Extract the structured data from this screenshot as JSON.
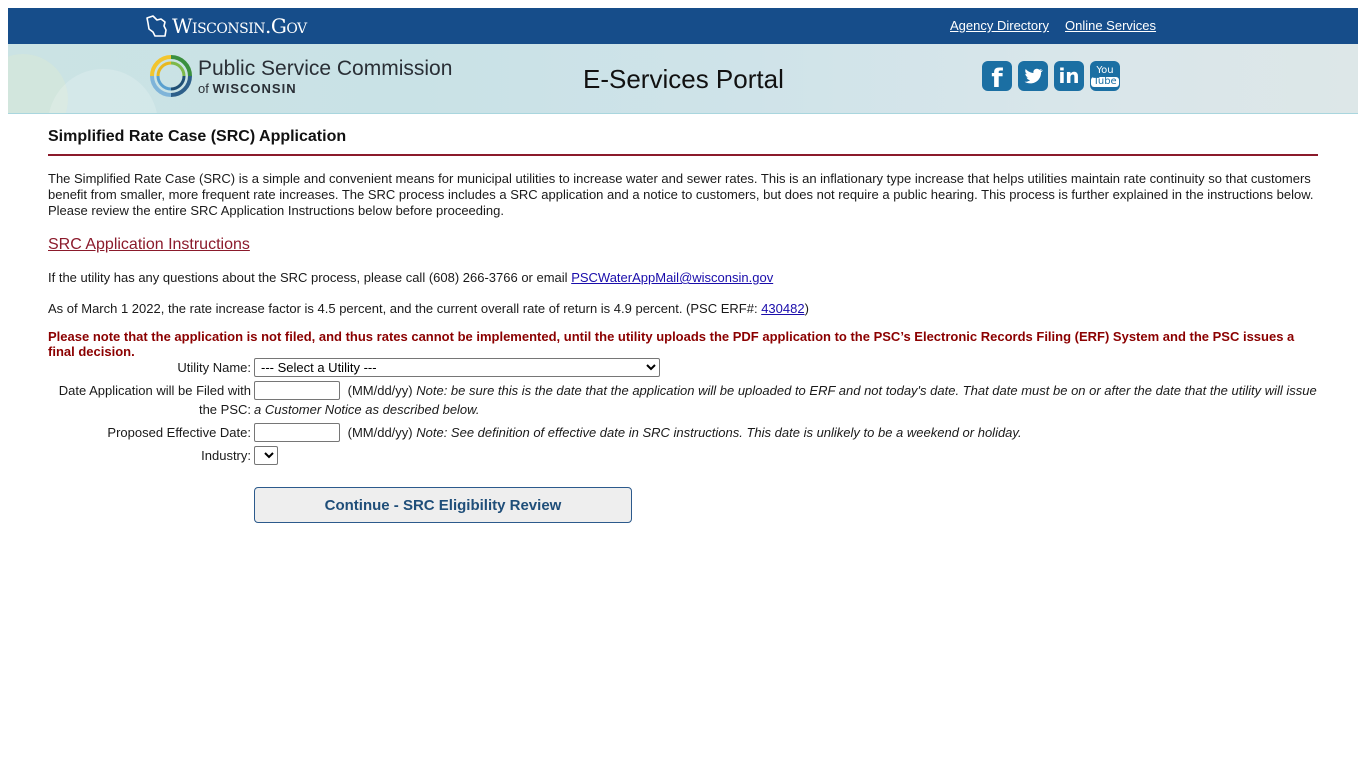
{
  "govbar": {
    "wordmark": "Wisconsin.Gov",
    "links": [
      {
        "label": "Agency Directory"
      },
      {
        "label": "Online Services"
      }
    ]
  },
  "banner": {
    "org_line1": "Public Service Commission",
    "org_line2_prefix": "of",
    "org_line2_bold": "WISCONSIN",
    "portal_title": "E-Services Portal",
    "social": [
      {
        "name": "facebook-icon",
        "glyph": "f"
      },
      {
        "name": "twitter-icon",
        "glyph": ""
      },
      {
        "name": "linkedin-icon",
        "glyph": "in"
      },
      {
        "name": "youtube-icon",
        "glyph_top": "You",
        "glyph_bottom": "Tube"
      }
    ],
    "colors": {
      "govbar": "#164d8a",
      "social": "#1b6fa3"
    }
  },
  "page": {
    "title": "Simplified Rate Case (SRC) Application",
    "intro": "The Simplified Rate Case (SRC) is a simple and convenient means for municipal utilities to increase water and sewer rates. This is an inflationary type increase that helps utilities maintain rate continuity so that customers benefit from smaller, more frequent rate increases. The SRC process includes a SRC application and a notice to customers, but does not require a public hearing. This process is further explained in the instructions below. Please review the entire SRC Application Instructions below before proceeding.",
    "instructions_link": "SRC Application Instructions",
    "contact_prefix": "If the utility has any questions about the SRC process, please call (608) 266-3766 or email ",
    "contact_email": "PSCWaterAppMail@wisconsin.gov",
    "rate_prefix": "As of March 1 2022, the rate increase factor is 4.5 percent, and the current overall rate of return is 4.9 percent. (PSC ERF#: ",
    "rate_erf_link": "430482",
    "rate_suffix": ")",
    "warning": "Please note that the application is not filed, and thus rates cannot be implemented, until the utility uploads the PDF application to the PSC’s Electronic Records Filing (ERF) System and the PSC issues a final decision.",
    "accent_color": "#8b1a2b"
  },
  "form": {
    "utility_label": "Utility Name:",
    "utility_selected": "--- Select a Utility ---",
    "filed_label": "Date Application will be Filed with the PSC:",
    "filed_value": "",
    "filed_format": "(MM/dd/yy)",
    "filed_note": "Note: be sure this is the date that the application will be uploaded to ERF and not today's date. That date must be on or after the date that the utility will issue a Customer Notice as described below.",
    "effective_label": "Proposed Effective Date:",
    "effective_value": "",
    "effective_format": "(MM/dd/yy)",
    "effective_note": "Note: See definition of effective date in SRC instructions. This date is unlikely to be a weekend or holiday.",
    "industry_label": "Industry:",
    "industry_selected": "",
    "continue_label": "Continue - SRC Eligibility Review"
  }
}
